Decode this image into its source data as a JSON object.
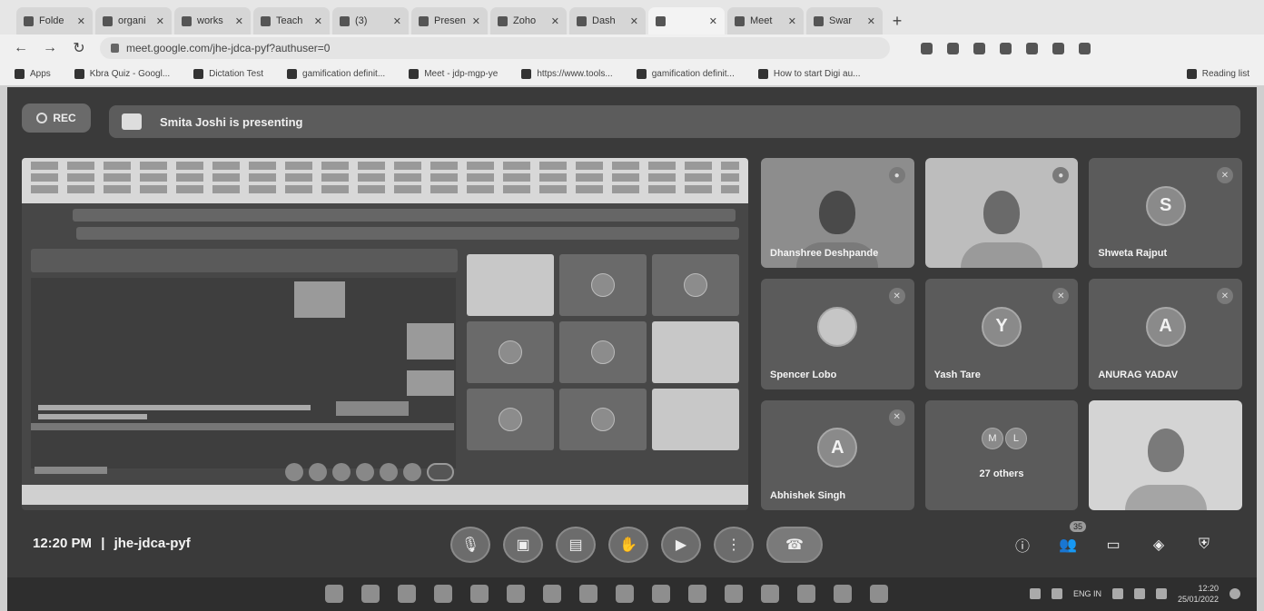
{
  "browser": {
    "tabs": [
      {
        "label": "Folde",
        "active": false
      },
      {
        "label": "organi",
        "active": false
      },
      {
        "label": "works",
        "active": false
      },
      {
        "label": "Teach",
        "active": false
      },
      {
        "label": "(3)",
        "active": false
      },
      {
        "label": "Presen",
        "active": false
      },
      {
        "label": "Zoho",
        "active": false
      },
      {
        "label": "Dash",
        "active": false
      },
      {
        "label": "",
        "active": true
      },
      {
        "label": "Meet",
        "active": false
      },
      {
        "label": "Swar",
        "active": false
      }
    ],
    "new_tab": "+",
    "url": "meet.google.com/jhe-jdca-pyf?authuser=0",
    "bookmarks": [
      "Apps",
      "Kbra Quiz - Googl...",
      "Dictation Test",
      "gamification definit...",
      "Meet - jdp-mgp-ye",
      "https://www.tools...",
      "gamification definit...",
      "How to start Digi au..."
    ],
    "reading_list": "Reading list"
  },
  "meet": {
    "rec_label": "REC",
    "presenting_text": "Smita Joshi is presenting",
    "participants": [
      {
        "name": "Dhanshree Deshpande",
        "type": "video"
      },
      {
        "name": "",
        "type": "video"
      },
      {
        "name": "Shweta Rajput",
        "type": "avatar",
        "initial": "S"
      },
      {
        "name": "Spencer Lobo",
        "type": "photo-avatar",
        "initial": ""
      },
      {
        "name": "Yash Tare",
        "type": "avatar",
        "initial": "Y"
      },
      {
        "name": "ANURAG YADAV",
        "type": "avatar",
        "initial": "A"
      },
      {
        "name": "Abhishek Singh",
        "type": "avatar",
        "initial": "A"
      },
      {
        "name": "27 others",
        "type": "others",
        "initials": [
          "M",
          "L"
        ]
      },
      {
        "name": "",
        "type": "video"
      }
    ],
    "meeting_time": "12:20 PM",
    "separator": "|",
    "meeting_code": "jhe-jdca-pyf",
    "people_count": "35",
    "colors": {
      "background": "#3a3a3a",
      "tile": "#5b5b5b",
      "text": "#f4f4f4"
    }
  },
  "taskbar": {
    "tray_lang": "ENG IN",
    "time": "12:20",
    "date": "25/01/2022"
  }
}
